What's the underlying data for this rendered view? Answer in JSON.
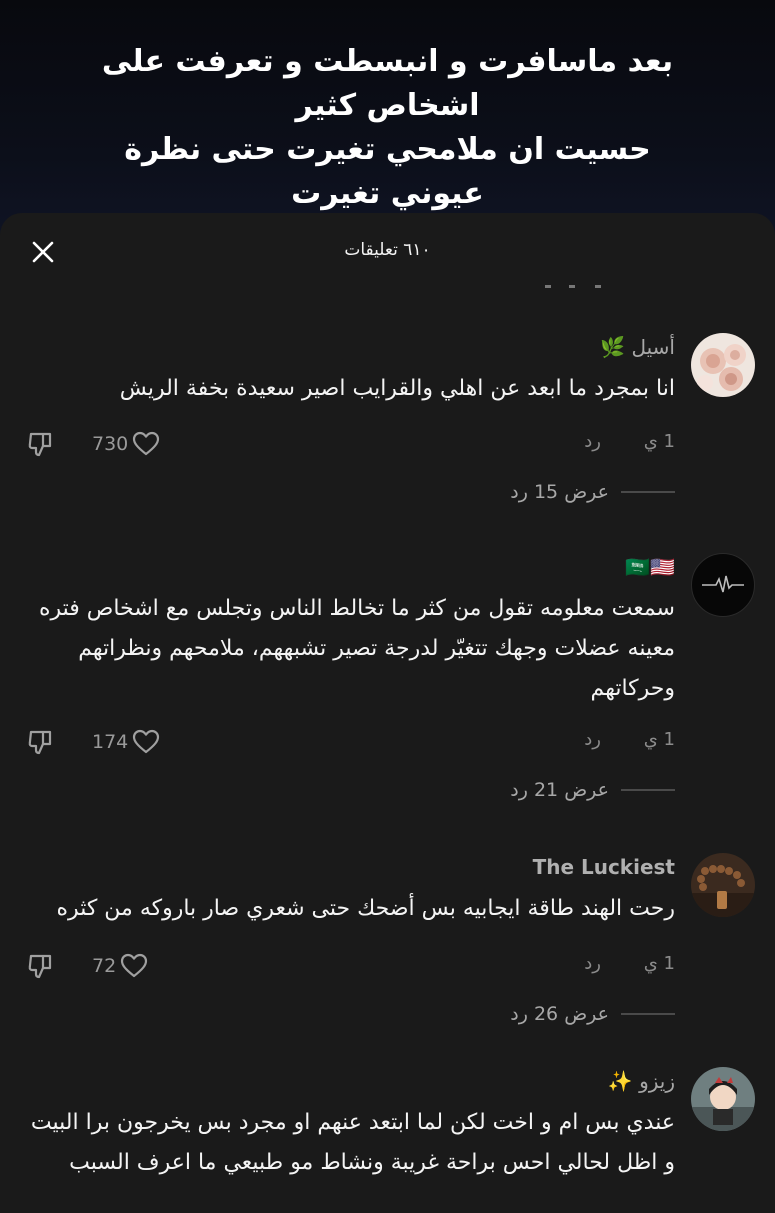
{
  "video": {
    "caption": "بعد ماسافرت و انبسطت و تعرفت على\nاشخاص كثير\nحسيت ان ملامحي تغيرت حتى نظرة\nعيوني تغيرت\nكذا اتقلبت... "
  },
  "sheet": {
    "title": "٦١٠ تعليقات",
    "close_icon": "close-icon"
  },
  "colors": {
    "sheet_bg": "#1a1a1a",
    "text_primary": "#f4f4f4",
    "text_secondary": "#8c8c8c"
  },
  "comments": [
    {
      "username": "أسيل 🌿",
      "text": "انا بمجرد ما ابعد عن اهلي والقرايب اصير سعيدة بخفة الريش",
      "time": "1 ي",
      "reply_label": "رد",
      "likes": "730",
      "view_replies": "عرض 15 رد",
      "avatar_icon": "roses-avatar"
    },
    {
      "username": "🇸🇦🇺🇸",
      "text": "سمعت معلومه تقول من كثر ما تخالط الناس وتجلس مع اشخاص فتره معينه عضلات وجهك تتغيّر لدرجة تصير تشبههم، ملامحهم ونظراتهم وحركاتهم",
      "time": "1 ي",
      "reply_label": "رد",
      "likes": "174",
      "view_replies": "عرض 21 رد",
      "avatar_icon": "heartbeat-avatar"
    },
    {
      "username": "The Luckiest",
      "text": "رحت الهند طاقة ايجابيه بس أضحك حتى شعري صار باروكه من كثره",
      "time": "1 ي",
      "reply_label": "رد",
      "likes": "72",
      "view_replies": "عرض 26 رد",
      "avatar_icon": "prayer-beads-avatar"
    },
    {
      "username": "زيزو ✨",
      "text": "عندي بس ام و اخت لكن لما ابتعد عنهم او مجرد بس يخرجون برا البيت و اظل لحالي احس براحة غريبة ونشاط مو طبيعي ما اعرف السبب",
      "avatar_icon": "anime-girl-avatar"
    }
  ]
}
